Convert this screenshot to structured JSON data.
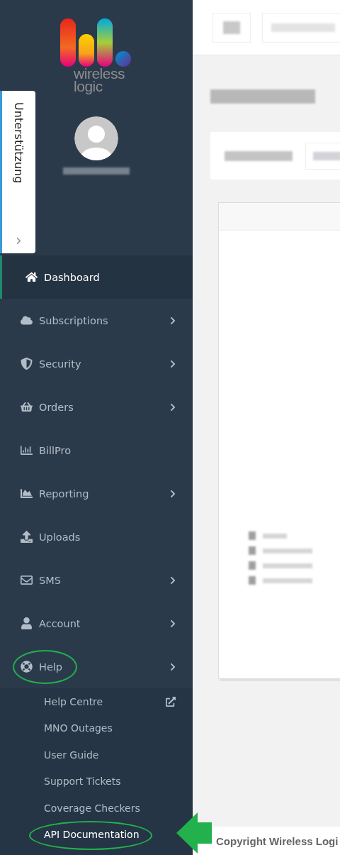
{
  "logo": {
    "line_1": "wireless",
    "line_2": "logic"
  },
  "support_tab": {
    "label": "Unterstützung",
    "collapsed": true
  },
  "menu": [
    {
      "label": "Dashboard",
      "selected": true,
      "has_submenu": false,
      "circled": false
    },
    {
      "label": "Subscriptions",
      "selected": false,
      "has_submenu": true,
      "circled": false
    },
    {
      "label": "Security",
      "selected": false,
      "has_submenu": true,
      "circled": false
    },
    {
      "label": "Orders",
      "selected": false,
      "has_submenu": true,
      "circled": false
    },
    {
      "label": "BillPro",
      "selected": false,
      "has_submenu": false,
      "circled": false
    },
    {
      "label": "Reporting",
      "selected": false,
      "has_submenu": true,
      "circled": false
    },
    {
      "label": "Uploads",
      "selected": false,
      "has_submenu": false,
      "circled": false
    },
    {
      "label": "SMS",
      "selected": false,
      "has_submenu": true,
      "circled": false
    },
    {
      "label": "Account",
      "selected": false,
      "has_submenu": true,
      "circled": false
    },
    {
      "label": "Help",
      "selected": false,
      "has_submenu": true,
      "circled": true,
      "children": [
        {
          "label": "Help Centre",
          "external": true,
          "selected": false,
          "circled": false
        },
        {
          "label": "MNO Outages",
          "external": false,
          "selected": false,
          "circled": false
        },
        {
          "label": "User Guide",
          "external": false,
          "selected": false,
          "circled": false
        },
        {
          "label": "Support Tickets",
          "external": false,
          "selected": false,
          "circled": false
        },
        {
          "label": "Coverage Checkers",
          "external": false,
          "selected": false,
          "circled": false
        },
        {
          "label": "API Documentation",
          "external": false,
          "selected": true,
          "circled": true
        }
      ]
    }
  ],
  "annotations": [
    {
      "kind": "arrow"
    }
  ],
  "footer": {
    "text": "Copyright Wireless Logi"
  }
}
